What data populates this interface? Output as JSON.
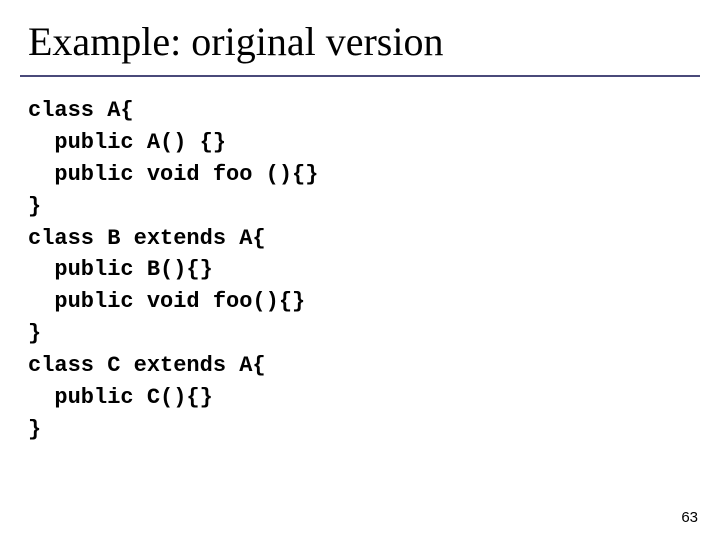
{
  "title": "Example: original version",
  "code": "class A{\n  public A() {}\n  public void foo (){}\n}\nclass B extends A{\n  public B(){}\n  public void foo(){}\n}\nclass C extends A{\n  public C(){}\n}",
  "page_number": "63"
}
